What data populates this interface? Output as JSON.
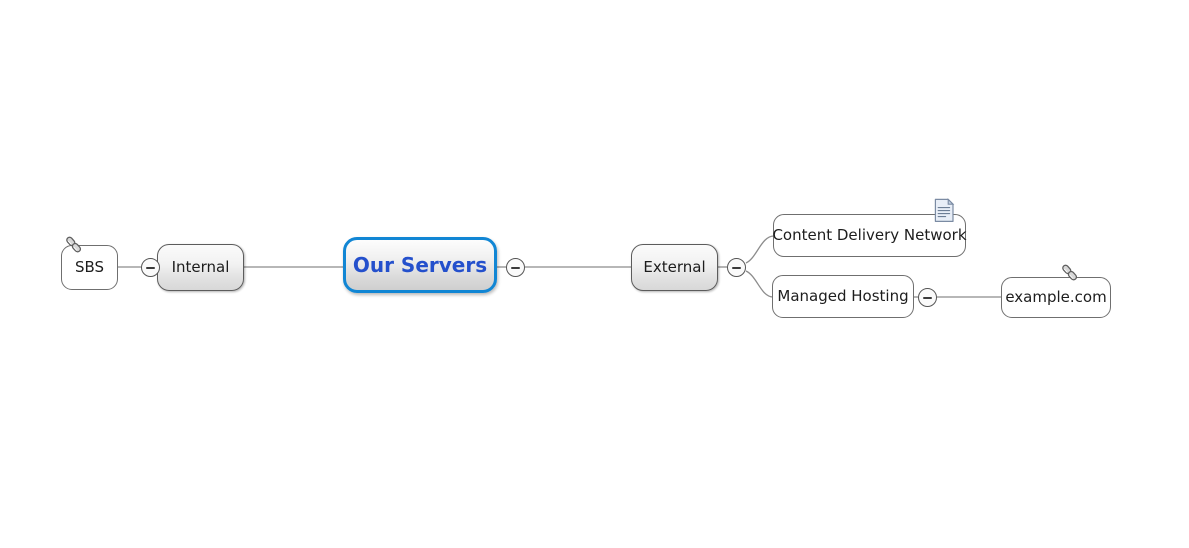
{
  "document": {
    "title": "Our Servers",
    "background_color": "#ffffff",
    "type": "mind-map"
  },
  "theme": {
    "root_border_color": "#1186d4",
    "root_text_color": "#2450cc",
    "node_border_color": "#5c5c5c",
    "leaf_border_color": "#6f6f6f",
    "node_text_color": "#1d1d1d",
    "connector_color": "#8c8c8c",
    "toggle_border_color": "#565656"
  },
  "nodes": {
    "root": {
      "label": "Our Servers"
    },
    "internal": {
      "label": "Internal"
    },
    "sbs": {
      "label": "SBS"
    },
    "external": {
      "label": "External"
    },
    "cdn": {
      "label": "Content Delivery Network"
    },
    "managed_hosting": {
      "label": "Managed Hosting"
    },
    "example": {
      "label": "example.com"
    }
  },
  "icons": {
    "sbs_link": "link-icon",
    "example_link": "link-icon",
    "cdn_note": "note-icon"
  },
  "toggles": {
    "sbs_internal": {
      "state": "expanded",
      "symbol": "minus"
    },
    "root_right": {
      "state": "expanded",
      "symbol": "minus"
    },
    "external_children": {
      "state": "expanded",
      "symbol": "minus"
    },
    "managed_hosting_child": {
      "state": "expanded",
      "symbol": "minus"
    }
  }
}
